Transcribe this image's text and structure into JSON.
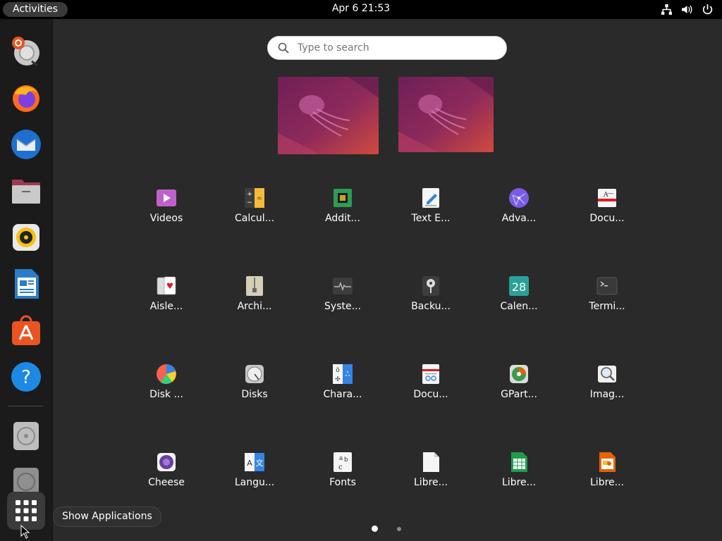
{
  "topbar": {
    "activities_label": "Activities",
    "clock": "Apr 6  21:53",
    "tray_icons": [
      "network-icon",
      "volume-icon",
      "power-icon"
    ]
  },
  "dock": {
    "items": [
      {
        "name": "ubuntu-installer",
        "icon": "installer-icon"
      },
      {
        "name": "firefox",
        "icon": "firefox-icon"
      },
      {
        "name": "thunderbird",
        "icon": "thunderbird-icon"
      },
      {
        "name": "files",
        "icon": "files-icon"
      },
      {
        "name": "rhythmbox",
        "icon": "rhythmbox-icon"
      },
      {
        "name": "libreoffice-writer",
        "icon": "writer-icon"
      },
      {
        "name": "ubuntu-software",
        "icon": "software-icon"
      },
      {
        "name": "help",
        "icon": "help-icon"
      },
      {
        "name": "optical-drive-1",
        "icon": "disc-icon"
      },
      {
        "name": "optical-drive-2",
        "icon": "disc-icon"
      },
      {
        "name": "show-applications",
        "icon": "app-grid-icon"
      }
    ],
    "show_apps_tooltip": "Show Applications"
  },
  "search": {
    "placeholder": "Type to search"
  },
  "workspaces": {
    "count": 2
  },
  "apps": {
    "rows": [
      [
        {
          "label": "Videos",
          "icon": "videos-icon"
        },
        {
          "label": "Calcul...",
          "icon": "calculator-icon"
        },
        {
          "label": "Addit...",
          "icon": "additional-drivers-icon"
        },
        {
          "label": "Text E...",
          "icon": "text-editor-icon"
        },
        {
          "label": "Adva...",
          "icon": "advanced-network-icon"
        },
        {
          "label": "Docu...",
          "icon": "document-viewer-icon"
        }
      ],
      [
        {
          "label": "Aisle...",
          "icon": "aisleriot-icon"
        },
        {
          "label": "Archi...",
          "icon": "archive-manager-icon"
        },
        {
          "label": "Syste...",
          "icon": "system-monitor-icon"
        },
        {
          "label": "Backu...",
          "icon": "backups-icon"
        },
        {
          "label": "Calen...",
          "icon": "calendar-icon"
        },
        {
          "label": "Termi...",
          "icon": "terminal-icon"
        }
      ],
      [
        {
          "label": "Disk ...",
          "icon": "disk-usage-icon"
        },
        {
          "label": "Disks",
          "icon": "disks-icon"
        },
        {
          "label": "Chara...",
          "icon": "characters-icon"
        },
        {
          "label": "Docu...",
          "icon": "document-scanner-icon"
        },
        {
          "label": "GPart...",
          "icon": "gparted-icon"
        },
        {
          "label": "Imag...",
          "icon": "image-viewer-icon"
        }
      ],
      [
        {
          "label": "Cheese",
          "icon": "cheese-icon"
        },
        {
          "label": "Langu...",
          "icon": "language-support-icon"
        },
        {
          "label": "Fonts",
          "icon": "fonts-icon"
        },
        {
          "label": "Libre...",
          "icon": "libreoffice-icon"
        },
        {
          "label": "Libre...",
          "icon": "libreoffice-calc-icon"
        },
        {
          "label": "Libre...",
          "icon": "libreoffice-impress-icon"
        }
      ]
    ],
    "calendar_day": "28"
  },
  "pagination": {
    "pages": 2,
    "current": 1
  },
  "colors": {
    "topbar": "#000000",
    "dock": "#1b1b1b",
    "workspace": "#2a2a2a"
  }
}
